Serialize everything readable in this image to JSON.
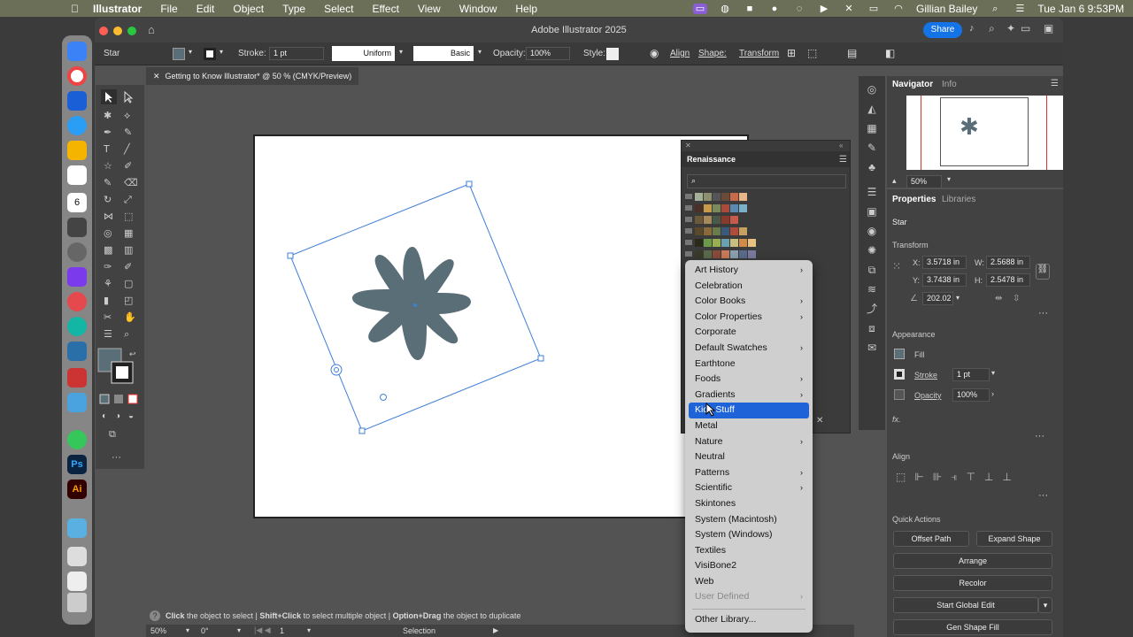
{
  "menubar": {
    "app_name": "Illustrator",
    "items": [
      "File",
      "Edit",
      "Object",
      "Type",
      "Select",
      "Effect",
      "View",
      "Window",
      "Help"
    ],
    "user": "Gillian Bailey",
    "datetime": "Tue Jan 6  9:53PM"
  },
  "window": {
    "title": "Adobe Illustrator 2025",
    "share_label": "Share"
  },
  "control_bar": {
    "selection": "Star",
    "stroke_label": "Stroke:",
    "stroke_value": "1 pt",
    "profile": "Uniform",
    "brush": "Basic",
    "opacity_label": "Opacity:",
    "opacity_value": "100%",
    "style_label": "Style:",
    "align_label": "Align",
    "shape_label": "Shape:",
    "transform_label": "Transform"
  },
  "document_tab": "Getting to Know Illustrator* @ 50 % (CMYK/Preview)",
  "status": {
    "hint_click": "Click",
    "hint_click_rest": " the object to select  |  ",
    "hint_shift": "Shift+Click",
    "hint_shift_rest": " to select multiple object  |  ",
    "hint_option": "Option+Drag",
    "hint_option_rest": " the object to duplicate",
    "zoom": "50%",
    "rotation": "0°",
    "artboard_num": "1",
    "mode": "Selection"
  },
  "navigator": {
    "tab_active": "Navigator",
    "tab_other": "Info",
    "zoom": "50%"
  },
  "properties": {
    "tab_active": "Properties",
    "tab_other": "Libraries",
    "object": "Star",
    "transform_title": "Transform",
    "x_label": "X:",
    "x_value": "3.5718 in",
    "y_label": "Y:",
    "y_value": "3.7438 in",
    "w_label": "W:",
    "w_value": "2.5688 in",
    "h_label": "H:",
    "h_value": "2.5478 in",
    "angle_value": "202.02",
    "appearance_title": "Appearance",
    "fill_label": "Fill",
    "stroke_label": "Stroke",
    "stroke_value": "1 pt",
    "opacity_label": "Opacity",
    "opacity_value": "100%",
    "fx_label": "fx.",
    "align_title": "Align",
    "quick_actions_title": "Quick Actions",
    "offset_path": "Offset Path",
    "expand_shape": "Expand Shape",
    "arrange": "Arrange",
    "recolor": "Recolor",
    "start_global_edit": "Start Global Edit",
    "gen_shape_fill": "Gen Shape Fill"
  },
  "swatch_panel": {
    "title": "Renaissance"
  },
  "library_menu": {
    "items": [
      {
        "label": "Art History",
        "submenu": true
      },
      {
        "label": "Celebration",
        "submenu": false
      },
      {
        "label": "Color Books",
        "submenu": true
      },
      {
        "label": "Color Properties",
        "submenu": true
      },
      {
        "label": "Corporate",
        "submenu": false
      },
      {
        "label": "Default Swatches",
        "submenu": true
      },
      {
        "label": "Earthtone",
        "submenu": false
      },
      {
        "label": "Foods",
        "submenu": true
      },
      {
        "label": "Gradients",
        "submenu": true
      },
      {
        "label": "Kids Stuff",
        "submenu": false,
        "selected": true
      },
      {
        "label": "Metal",
        "submenu": false
      },
      {
        "label": "Nature",
        "submenu": true
      },
      {
        "label": "Neutral",
        "submenu": false
      },
      {
        "label": "Patterns",
        "submenu": true
      },
      {
        "label": "Scientific",
        "submenu": true
      },
      {
        "label": "Skintones",
        "submenu": false
      },
      {
        "label": "System (Macintosh)",
        "submenu": false
      },
      {
        "label": "System (Windows)",
        "submenu": false
      },
      {
        "label": "Textiles",
        "submenu": false
      },
      {
        "label": "VisiBone2",
        "submenu": false
      },
      {
        "label": "Web",
        "submenu": false
      },
      {
        "label": "User Defined",
        "submenu": true,
        "disabled": true
      }
    ],
    "other_library": "Other Library..."
  },
  "colors": {
    "star_fill": "#5a6e78",
    "selection": "#3f7fd8",
    "menu_highlight": "#1f63d8"
  }
}
